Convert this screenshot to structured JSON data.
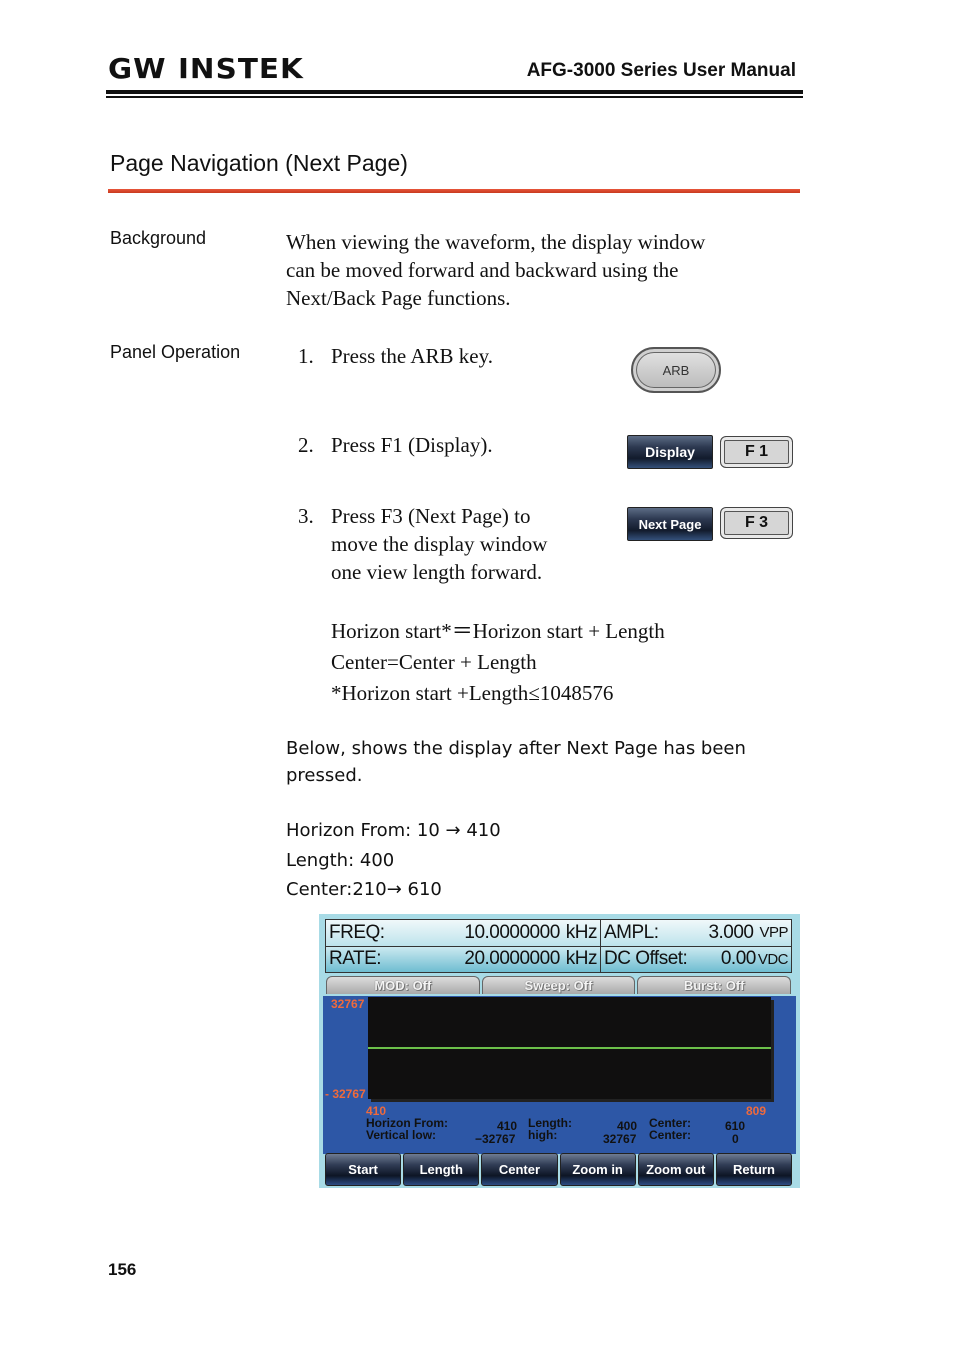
{
  "header": {
    "logo": "GW INSTEK",
    "manual_title": "AFG-3000 Series User Manual"
  },
  "section": {
    "title": "Page Navigation (Next Page)"
  },
  "background": {
    "label": "Background",
    "lines": [
      "When viewing the waveform, the display window",
      "can be moved forward and backward using the",
      "Next/Back Page functions."
    ]
  },
  "panel_operation": {
    "label": "Panel Operation",
    "steps": [
      {
        "num": "1.",
        "lines": [
          "Press the ARB key."
        ]
      },
      {
        "num": "2.",
        "lines": [
          "Press F1 (Display)."
        ]
      },
      {
        "num": "3.",
        "lines": [
          "Press F3 (Next Page) to",
          "move the display window",
          "one view length forward."
        ]
      }
    ],
    "formulas": [
      "Horizon start*＝Horizon start + Length",
      "Center=Center + Length",
      "*Horizon start +Length≤1048576"
    ],
    "note_lines": [
      "Below, shows the display after Next Page has been",
      "pressed."
    ],
    "changes": [
      "Horizon From: 10 → 410",
      "Length: 400",
      "Center:210→ 610"
    ]
  },
  "keys": {
    "arb": "ARB",
    "display_soft": "Display",
    "f1": "F 1",
    "next_page_soft": "Next Page",
    "f3": "F 3"
  },
  "screen": {
    "freq_label": "FREQ:",
    "freq_value": "10.0000000",
    "freq_unit": "kHz",
    "ampl_label": "AMPL:",
    "ampl_value": "3.000",
    "ampl_unit": "VPP",
    "rate_label": "RATE:",
    "rate_value": "20.0000000",
    "rate_unit": "kHz",
    "dc_label": "DC Offset:",
    "dc_value": "0.00",
    "dc_unit": "VDC",
    "mode_tabs": [
      "MOD: Off",
      "Sweep: Off",
      "Burst: Off"
    ],
    "y_top": "32767",
    "y_bottom": "- 32767",
    "x_start": "410",
    "x_end": "809",
    "status": {
      "horizon_from_label": "Horizon From:",
      "horizon_from_value": "410",
      "length_label": "Length:",
      "length_value": "400",
      "center_label": "Center:",
      "center_value": "610",
      "vertical_low_label": "Vertical low:",
      "vertical_low_value": "−32767",
      "high_label": "high:",
      "high_value": "32767",
      "v_center_label": "Center:",
      "v_center_value": "0"
    },
    "func_buttons": [
      "Start",
      "Length",
      "Center",
      "Zoom in",
      "Zoom out",
      "Return"
    ],
    "trace_level": 0
  },
  "footer": {
    "page_number": "156"
  }
}
